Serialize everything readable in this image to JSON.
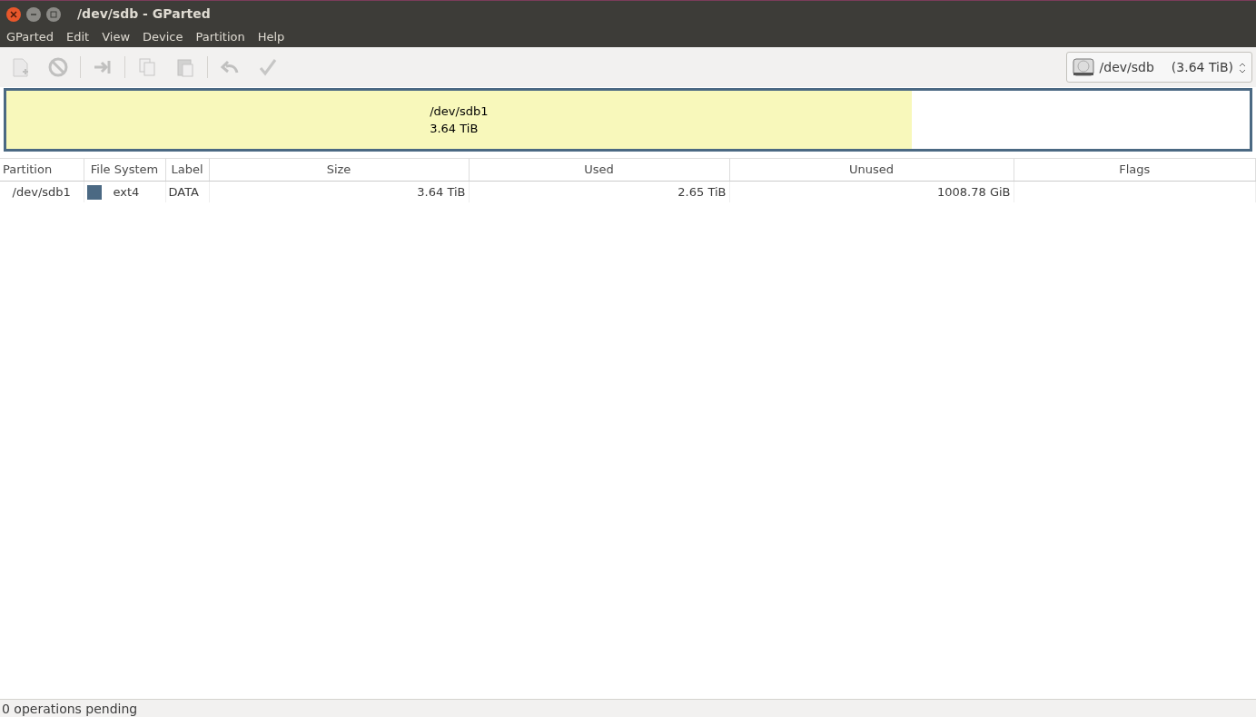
{
  "window": {
    "title": "/dev/sdb - GParted"
  },
  "menu": [
    "GParted",
    "Edit",
    "View",
    "Device",
    "Partition",
    "Help"
  ],
  "toolbar": [
    {
      "kind": "new",
      "disabled": true
    },
    {
      "kind": "delete",
      "disabled": true
    },
    {
      "kind": "sep"
    },
    {
      "kind": "resize",
      "disabled": true
    },
    {
      "kind": "sep"
    },
    {
      "kind": "copy",
      "disabled": true
    },
    {
      "kind": "paste",
      "disabled": true
    },
    {
      "kind": "sep"
    },
    {
      "kind": "undo",
      "disabled": true
    },
    {
      "kind": "apply",
      "disabled": true
    }
  ],
  "device": {
    "name": "/dev/sdb",
    "size": "(3.64 TiB)"
  },
  "partition_map": {
    "name": "/dev/sdb1",
    "size": "3.64 TiB",
    "level": 0.728
  },
  "table": {
    "columns": [
      "Partition",
      "File System",
      "Label",
      "Size",
      "Used",
      "Unused",
      "Flags"
    ],
    "rows": [
      {
        "partition": "/dev/sdb1",
        "color": "#4b6983",
        "filesystem": "ext4",
        "label": "DATA",
        "size": "3.64 TiB",
        "used": "2.65 TiB",
        "unused": "1008.78 GiB"
      }
    ]
  },
  "status_bar": "0 operations pending"
}
